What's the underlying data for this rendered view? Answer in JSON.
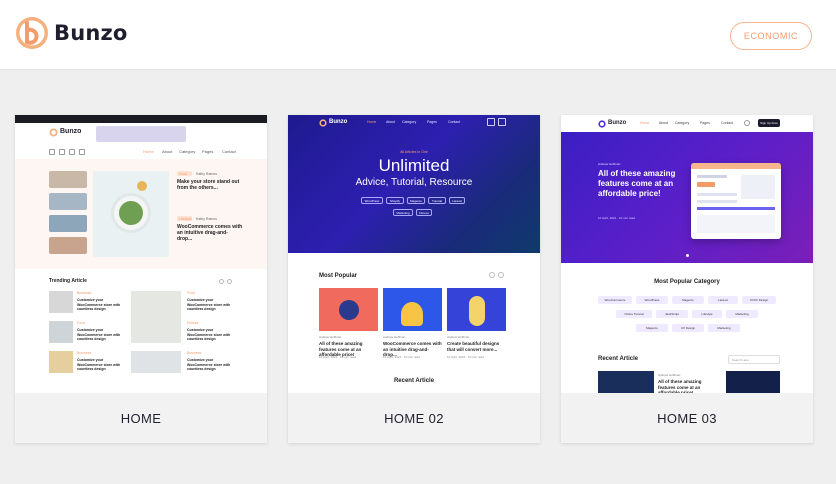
{
  "brand": {
    "name": "Bunzo",
    "accent": "#f39c6b"
  },
  "header": {
    "economic_label": "ECONOMIC"
  },
  "demos": [
    {
      "caption": "HOME",
      "mini": {
        "logo": "Bunzo",
        "nav": [
          "Home",
          "About",
          "Category",
          "Pages",
          "Contact"
        ],
        "badges": [
          "Food",
          "Lifestyle"
        ],
        "authors": [
          "Kathy Ramos",
          "Kathy Ramos"
        ],
        "titles": [
          "Make your store stand out from the others...",
          "WooCommerce comes with an intuitive drag-and-drop..."
        ],
        "trending_title": "Trending Article",
        "trending": [
          {
            "badge": "Business",
            "author": "Kathy Ramos",
            "title": "Customize your WooCommerce store with countless design"
          },
          {
            "badge": "Food",
            "author": "Kathy Ramos",
            "title": "Customize your WooCommerce store with countless design"
          },
          {
            "badge": "Business",
            "author": "Kathy Ramos",
            "title": "Customize your WooCommerce store with countless design"
          },
          {
            "badge": "Food",
            "author": "Kathy Ramos",
            "title": "Customize your WooCommerce store with countless design"
          },
          {
            "badge": "Fitness",
            "author": "Kathy Ramos",
            "title": "Customize your WooCommerce store with countless design"
          },
          {
            "badge": "Business",
            "author": "Kathy Ramos",
            "title": "Customize your WooCommerce store with countless design"
          }
        ]
      }
    },
    {
      "caption": "HOME 02",
      "mini": {
        "logo": "Bunzo",
        "nav": [
          "Home",
          "About",
          "Category",
          "Pages",
          "Contact"
        ],
        "kicker": "All Articles In One",
        "hero_title": "Unlimited",
        "hero_sub": "Advice, Tutorial, Resource",
        "tags": [
          "WordPress",
          "Shopify",
          "Magento",
          "Tutorial",
          "Laravel",
          "Marketing",
          "Fitness"
        ],
        "popular_title": "Most Popular",
        "cards": [
          {
            "author": "Andrew Hoffman",
            "title": "All of these amazing features come at an affordable price!",
            "meta": "10 April, 2021 · 10 min read"
          },
          {
            "author": "Andrew Hoffman",
            "title": "WooCommerce comes with an intuitive drag-and-drop...",
            "meta": "10 April, 2021 · 10 min read"
          },
          {
            "author": "Andrew Hoffman",
            "title": "Create beautiful designs that will convert more...",
            "meta": "10 April, 2021 · 10 min read"
          }
        ],
        "recent_title": "Recent Article"
      }
    },
    {
      "caption": "HOME 03",
      "mini": {
        "logo": "Bunzo",
        "nav": [
          "Home",
          "About",
          "Category",
          "Pages",
          "Contact"
        ],
        "cta": "Sign Up Free",
        "author": "Andrew Hoffman",
        "hero_title": "All of these amazing features come at an affordable price!",
        "meta": "10 April, 2021 · 10 min read",
        "category_title": "Most Popular Category",
        "categories": [
          "WooCommerce",
          "WordPress",
          "Magento",
          "Laravel",
          "UI/UX Design",
          "Online Tutorial",
          "JavaScript",
          "Lifestyle",
          "Marketing",
          "Magento",
          "UX Design",
          "Marketing"
        ],
        "recent_title": "Recent Article",
        "search_placeholder": "Search Here",
        "recent_author": "Andrew Hoffman",
        "recent_title_text": "All of these amazing features come at an affordable price!"
      }
    }
  ]
}
